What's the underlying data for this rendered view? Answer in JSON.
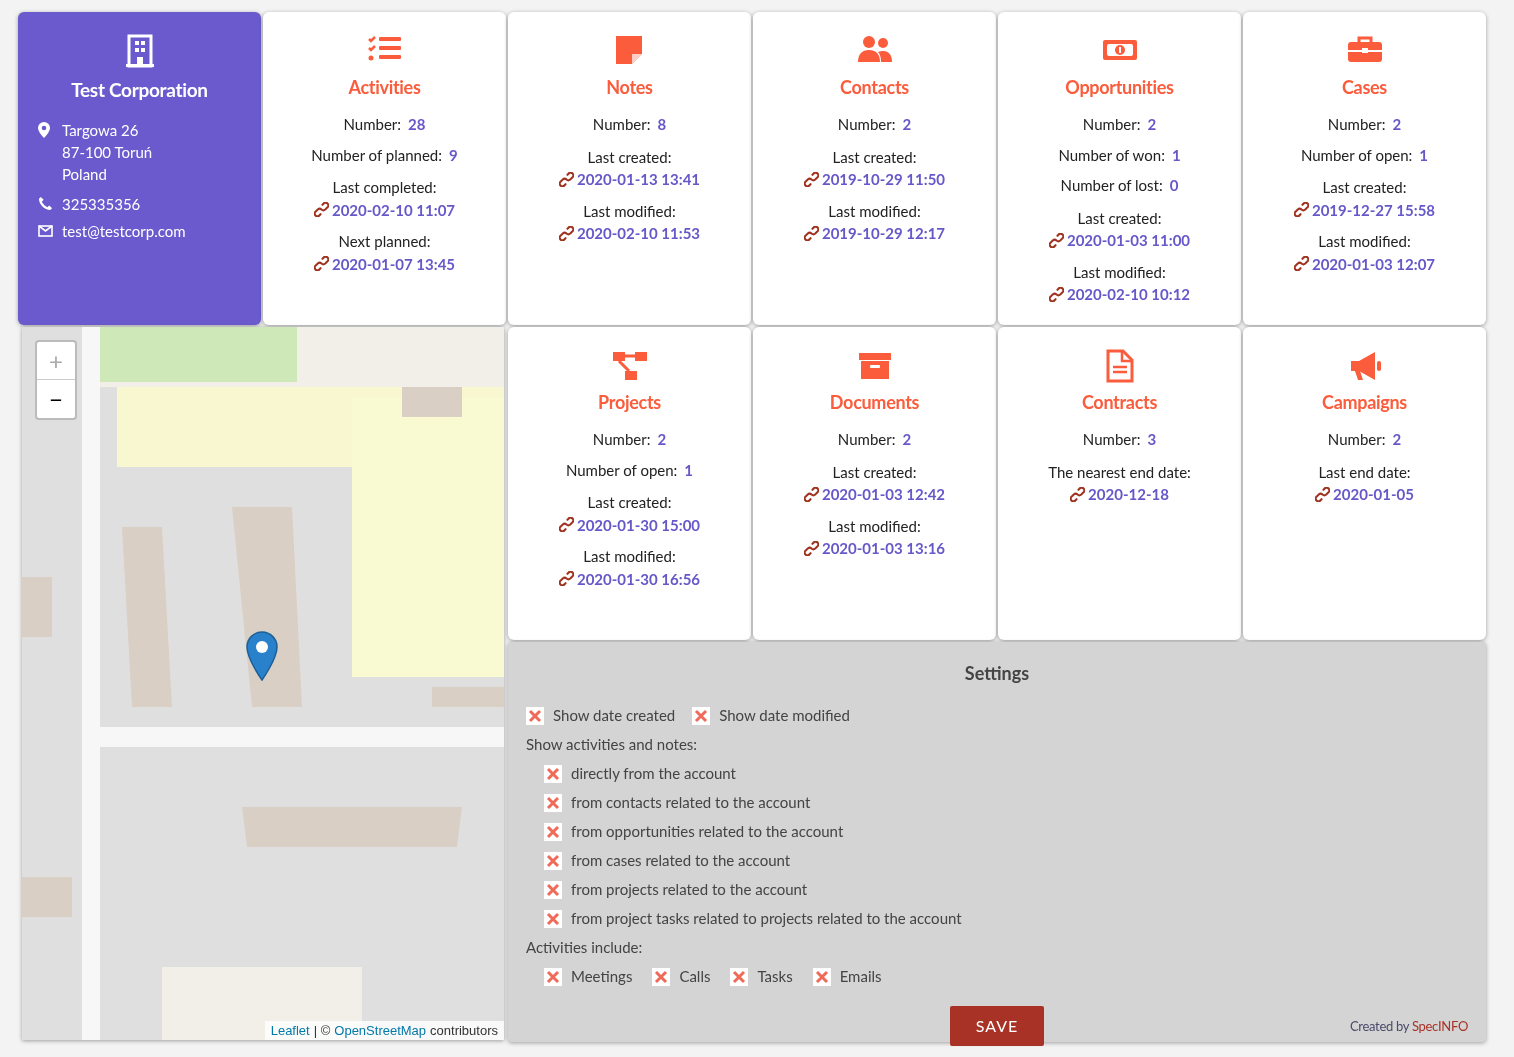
{
  "company": {
    "name": "Test Corporation",
    "address_lines": [
      "Targowa 26",
      "87-100 Toruń",
      "Poland"
    ],
    "phone": "325335356",
    "email": "test@testcorp.com"
  },
  "cards": [
    {
      "title": "Activities",
      "fields": [
        {
          "kind": "count",
          "label": "Number:",
          "value": "28"
        },
        {
          "kind": "count",
          "label": "Number of planned:",
          "value": "9"
        },
        {
          "kind": "date",
          "label": "Last completed:",
          "value": "2020-02-10 11:07"
        },
        {
          "kind": "date",
          "label": "Next planned:",
          "value": "2020-01-07 13:45"
        }
      ]
    },
    {
      "title": "Notes",
      "fields": [
        {
          "kind": "count",
          "label": "Number:",
          "value": "8"
        },
        {
          "kind": "date",
          "label": "Last created:",
          "value": "2020-01-13 13:41"
        },
        {
          "kind": "date",
          "label": "Last modified:",
          "value": "2020-02-10 11:53"
        }
      ]
    },
    {
      "title": "Contacts",
      "fields": [
        {
          "kind": "count",
          "label": "Number:",
          "value": "2"
        },
        {
          "kind": "date",
          "label": "Last created:",
          "value": "2019-10-29 11:50"
        },
        {
          "kind": "date",
          "label": "Last modified:",
          "value": "2019-10-29 12:17"
        }
      ]
    },
    {
      "title": "Opportunities",
      "fields": [
        {
          "kind": "count",
          "label": "Number:",
          "value": "2"
        },
        {
          "kind": "count",
          "label": "Number of won:",
          "value": "1"
        },
        {
          "kind": "count",
          "label": "Number of lost:",
          "value": "0"
        },
        {
          "kind": "date",
          "label": "Last created:",
          "value": "2020-01-03 11:00"
        },
        {
          "kind": "date",
          "label": "Last modified:",
          "value": "2020-02-10 10:12"
        }
      ]
    },
    {
      "title": "Cases",
      "fields": [
        {
          "kind": "count",
          "label": "Number:",
          "value": "2"
        },
        {
          "kind": "count",
          "label": "Number of open:",
          "value": "1"
        },
        {
          "kind": "date",
          "label": "Last created:",
          "value": "2019-12-27 15:58"
        },
        {
          "kind": "date",
          "label": "Last modified:",
          "value": "2020-01-03 12:07"
        }
      ]
    },
    {
      "title": "Projects",
      "fields": [
        {
          "kind": "count",
          "label": "Number:",
          "value": "2"
        },
        {
          "kind": "count",
          "label": "Number of open:",
          "value": "1"
        },
        {
          "kind": "date",
          "label": "Last created:",
          "value": "2020-01-30 15:00"
        },
        {
          "kind": "date",
          "label": "Last modified:",
          "value": "2020-01-30 16:56"
        }
      ]
    },
    {
      "title": "Documents",
      "fields": [
        {
          "kind": "count",
          "label": "Number:",
          "value": "2"
        },
        {
          "kind": "date",
          "label": "Last created:",
          "value": "2020-01-03 12:42"
        },
        {
          "kind": "date",
          "label": "Last modified:",
          "value": "2020-01-03 13:16"
        }
      ]
    },
    {
      "title": "Contracts",
      "fields": [
        {
          "kind": "count",
          "label": "Number:",
          "value": "3"
        },
        {
          "kind": "date",
          "label": "The nearest end date:",
          "value": "2020-12-18"
        }
      ]
    },
    {
      "title": "Campaigns",
      "fields": [
        {
          "kind": "count",
          "label": "Number:",
          "value": "2"
        },
        {
          "kind": "date",
          "label": "Last end date:",
          "value": "2020-01-05"
        }
      ]
    }
  ],
  "map": {
    "zoom_in": "+",
    "zoom_out": "−",
    "attribution": {
      "link1": "Leaflet",
      "separator": "| ©",
      "link2": "OpenStreetMap",
      "suffix": "contributors"
    }
  },
  "settings": {
    "title": "Settings",
    "top_options": [
      {
        "label": "Show date created",
        "checked": true
      },
      {
        "label": "Show date modified",
        "checked": true
      }
    ],
    "sources_label": "Show activities and notes:",
    "sources": [
      {
        "label": "directly from the account",
        "checked": true
      },
      {
        "label": "from contacts related to the account",
        "checked": true
      },
      {
        "label": "from opportunities related to the account",
        "checked": true
      },
      {
        "label": "from cases related to the account",
        "checked": true
      },
      {
        "label": "from projects related to the account",
        "checked": true
      },
      {
        "label": "from project tasks related to projects related to the account",
        "checked": true
      }
    ],
    "types_label": "Activities include:",
    "types": [
      {
        "label": "Meetings",
        "checked": true
      },
      {
        "label": "Calls",
        "checked": true
      },
      {
        "label": "Tasks",
        "checked": true
      },
      {
        "label": "Emails",
        "checked": true
      }
    ],
    "save": "SAVE",
    "credit": {
      "text": "Created by",
      "brand": "SpecINFO"
    }
  }
}
